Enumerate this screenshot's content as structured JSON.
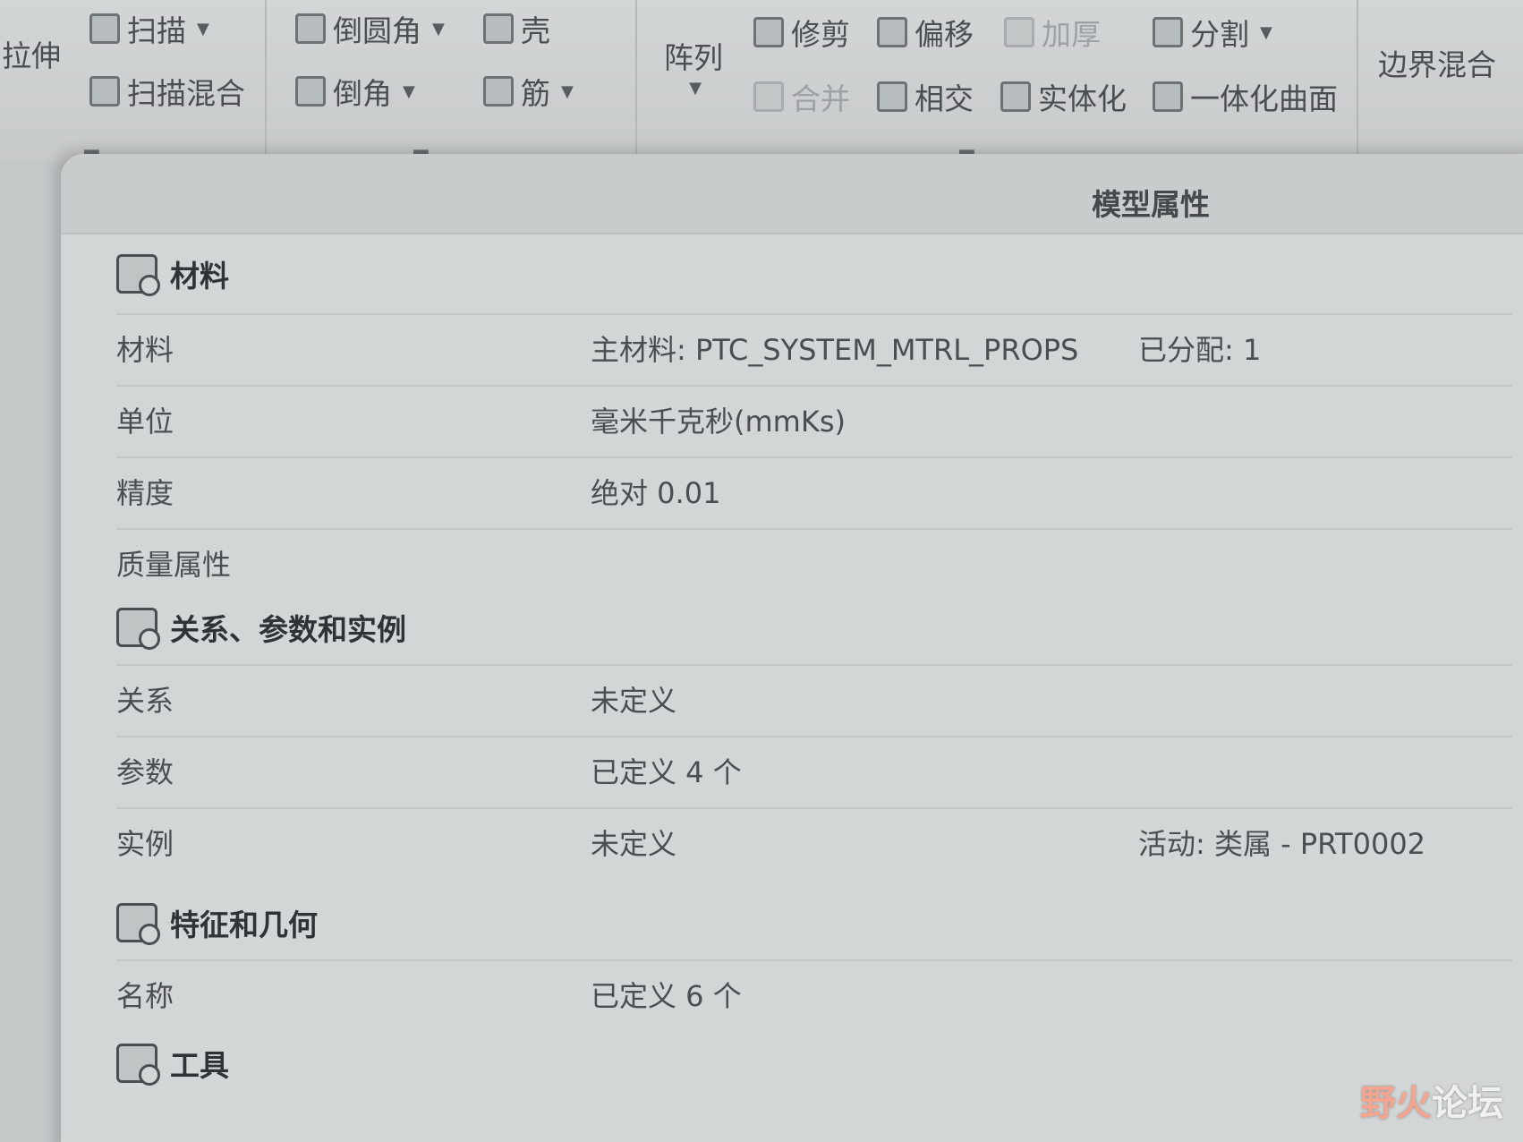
{
  "ribbon": {
    "extrude": "拉伸",
    "sweep": "扫描",
    "swept_blend": "扫描混合",
    "round": "倒圆角",
    "chamfer": "倒角",
    "shell": "壳",
    "rib": "筋",
    "pattern": "阵列",
    "trim": "修剪",
    "offset": "偏移",
    "thicken": "加厚",
    "split": "分割",
    "merge": "合并",
    "intersect": "相交",
    "solidify": "实体化",
    "unify_surface": "一体化曲面",
    "boundary_blend": "边界混合"
  },
  "dialog": {
    "title": "模型属性",
    "material_section": {
      "title": "材料",
      "rows": [
        {
          "label": "材料",
          "value": "主材料: PTC_SYSTEM_MTRL_PROPS",
          "aux": "已分配: 1"
        },
        {
          "label": "单位",
          "value": "毫米千克秒(mmKs)",
          "aux": ""
        },
        {
          "label": "精度",
          "value": "绝对 0.01",
          "aux": ""
        },
        {
          "label": "质量属性",
          "value": "",
          "aux": ""
        }
      ]
    },
    "relations_section": {
      "title": "关系、参数和实例",
      "rows": [
        {
          "label": "关系",
          "value": "未定义",
          "aux": ""
        },
        {
          "label": "参数",
          "value": "已定义 4 个",
          "aux": ""
        },
        {
          "label": "实例",
          "value": "未定义",
          "aux": "活动: 类属 - PRT0002"
        }
      ]
    },
    "features_section": {
      "title": "特征和几何",
      "rows": [
        {
          "label": "名称",
          "value": "已定义 6 个",
          "aux": ""
        }
      ]
    },
    "tools_section": {
      "title": "工具"
    }
  },
  "watermark": {
    "prefix": "野火",
    "suffix": "论坛"
  }
}
